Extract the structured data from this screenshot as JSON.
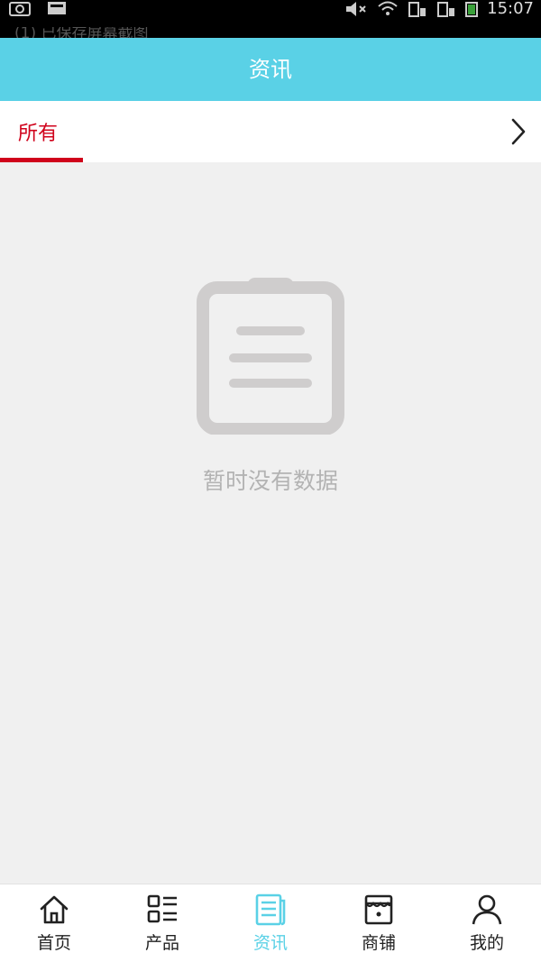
{
  "status_bar": {
    "time": "15:07",
    "notification_ghost": "(1) 已保存屏幕截图"
  },
  "header": {
    "title": "资讯"
  },
  "tabs": {
    "items": [
      {
        "label": "所有",
        "active": true
      }
    ],
    "more_icon": "chevron-right-icon"
  },
  "empty_state": {
    "icon": "clipboard-icon",
    "message": "暂时没有数据"
  },
  "bottom_nav": {
    "items": [
      {
        "label": "首页",
        "icon": "home-icon",
        "active": false
      },
      {
        "label": "产品",
        "icon": "list-grid-icon",
        "active": false
      },
      {
        "label": "资讯",
        "icon": "news-icon",
        "active": true
      },
      {
        "label": "商铺",
        "icon": "store-icon",
        "active": false
      },
      {
        "label": "我的",
        "icon": "user-icon",
        "active": false
      }
    ]
  },
  "colors": {
    "header_bg": "#5ad1e6",
    "tab_active": "#d0021b",
    "nav_active": "#5ad1e6",
    "page_bg": "#f0f0f0",
    "empty_icon": "#cfcdcd"
  }
}
